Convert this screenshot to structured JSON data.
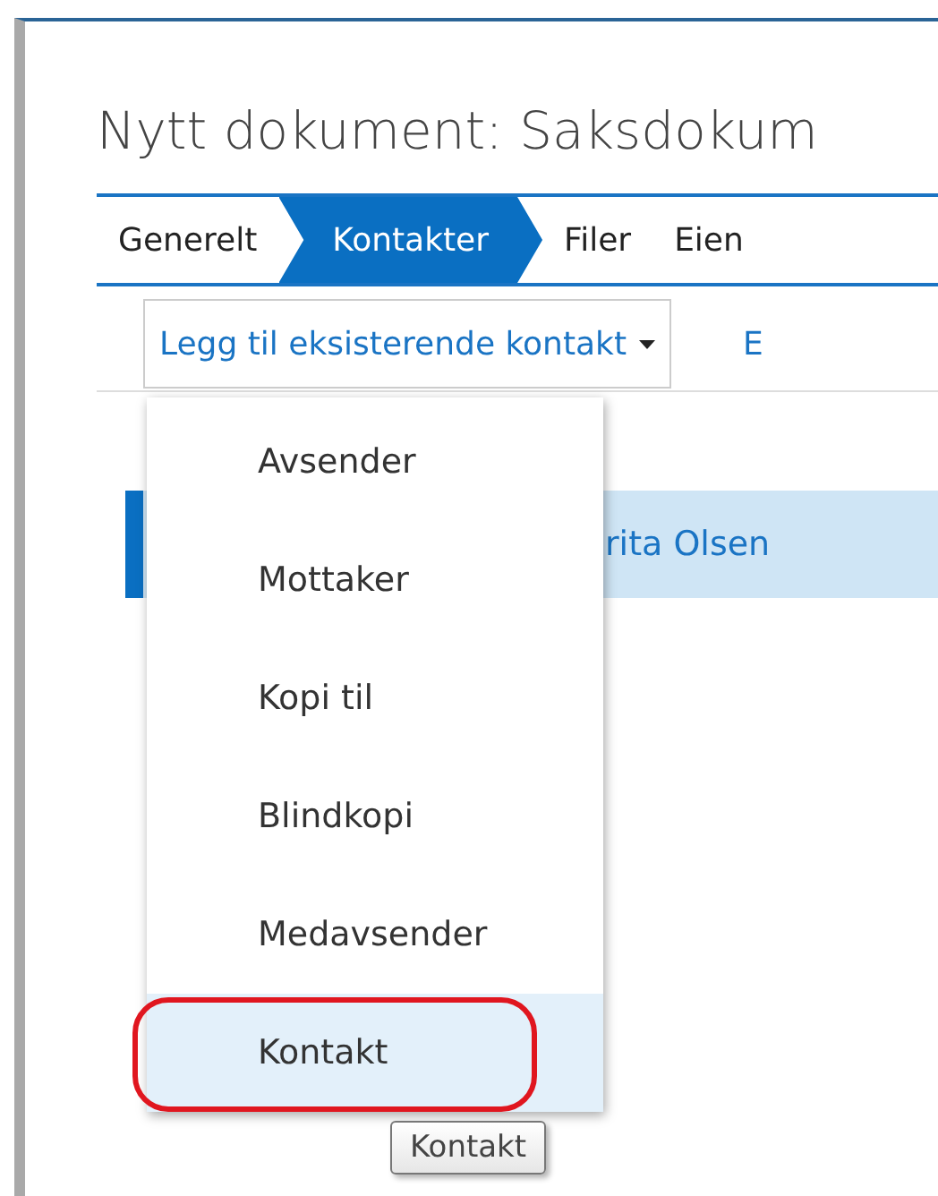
{
  "title": "Nytt dokument: Saksdokum",
  "tabs": [
    {
      "label": "Generelt",
      "selected": false
    },
    {
      "label": "Kontakter",
      "selected": true
    },
    {
      "label": "Filer",
      "selected": false
    },
    {
      "label": "Eien",
      "selected": false
    }
  ],
  "toolbar": [
    {
      "label": "Legg til eksisterende kontakt",
      "kind": "dropdown"
    },
    {
      "label": "E",
      "kind": "link"
    }
  ],
  "contacts": [
    {
      "name": "rita Olsen",
      "selected": true
    }
  ],
  "menu": {
    "items": [
      {
        "label": "Avsender",
        "highlighted": false,
        "circled": false
      },
      {
        "label": "Mottaker",
        "highlighted": false,
        "circled": false
      },
      {
        "label": "Kopi til",
        "highlighted": false,
        "circled": false
      },
      {
        "label": "Blindkopi",
        "highlighted": false,
        "circled": false
      },
      {
        "label": "Medavsender",
        "highlighted": false,
        "circled": false
      },
      {
        "label": "Kontakt",
        "highlighted": true,
        "circled": true
      }
    ]
  },
  "tooltip": "Kontakt"
}
